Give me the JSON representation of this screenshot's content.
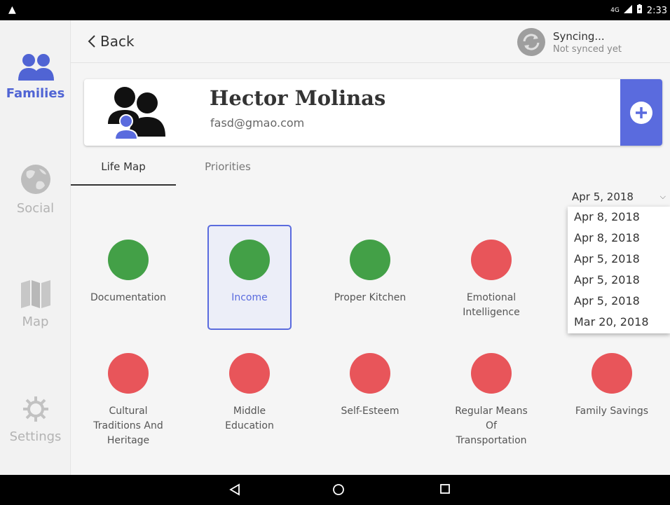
{
  "statusbar": {
    "network": "4G",
    "time": "2:33"
  },
  "sidebar": [
    {
      "label": "Families",
      "icon": "families-icon",
      "active": true
    },
    {
      "label": "Social",
      "icon": "globe-icon",
      "active": false
    },
    {
      "label": "Map",
      "icon": "map-icon",
      "active": false
    },
    {
      "label": "Settings",
      "icon": "gear-icon",
      "active": false
    }
  ],
  "header": {
    "back_label": "Back",
    "sync_title": "Syncing...",
    "sync_subtitle": "Not synced yet"
  },
  "family": {
    "name": "Hector Molinas",
    "email": "fasd@gmao.com"
  },
  "tabs": [
    {
      "label": "Life Map",
      "active": true
    },
    {
      "label": "Priorities",
      "active": false
    }
  ],
  "date_select": {
    "value": "Apr 5, 2018",
    "options": [
      "Apr 8, 2018",
      "Apr 8, 2018",
      "Apr 5, 2018",
      "Apr 5, 2018",
      "Apr 5, 2018",
      "Mar 20, 2018"
    ]
  },
  "indicators": [
    {
      "label": "Documentation",
      "status": "green",
      "selected": false
    },
    {
      "label": "Income",
      "status": "green",
      "selected": true
    },
    {
      "label": "Proper Kitchen",
      "status": "green",
      "selected": false
    },
    {
      "label": "Emotional Intelligence",
      "status": "red",
      "selected": false
    },
    {
      "label": "Cultural Traditions And Heritage",
      "status": "red",
      "selected": false
    },
    {
      "label": "Middle Education",
      "status": "red",
      "selected": false
    },
    {
      "label": "Self-Esteem",
      "status": "red",
      "selected": false
    },
    {
      "label": "Regular Means Of Transportation",
      "status": "red",
      "selected": false
    },
    {
      "label": "Family Savings",
      "status": "red",
      "selected": false
    }
  ],
  "colors": {
    "accent": "#5a6bde",
    "green": "#43a047",
    "red": "#e8555a",
    "yellow": "#f1c232"
  }
}
